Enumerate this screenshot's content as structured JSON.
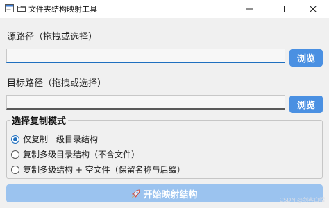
{
  "window": {
    "title": "文件夹结构映射工具"
  },
  "source": {
    "label": "源路径（拖拽或选择）",
    "value": "",
    "browse_label": "浏览"
  },
  "target": {
    "label": "目标路径（拖拽或选择）",
    "value": "",
    "browse_label": "浏览"
  },
  "mode": {
    "title": "选择复制模式",
    "options": [
      {
        "label": "仅复制一级目录结构",
        "checked": true
      },
      {
        "label": "复制多级目录结构（不含文件）",
        "checked": false
      },
      {
        "label": "复制多级结构 + 空文件（保留名称与后缀）",
        "checked": false
      }
    ]
  },
  "start_button": {
    "label": "开始映射结构",
    "icon": "rocket-icon"
  },
  "watermark": "CSDN @剑客白帽",
  "colors": {
    "accent": "#4a90e2",
    "start_button": "#9bc3ef",
    "radio_checked": "#1f6fbf"
  }
}
